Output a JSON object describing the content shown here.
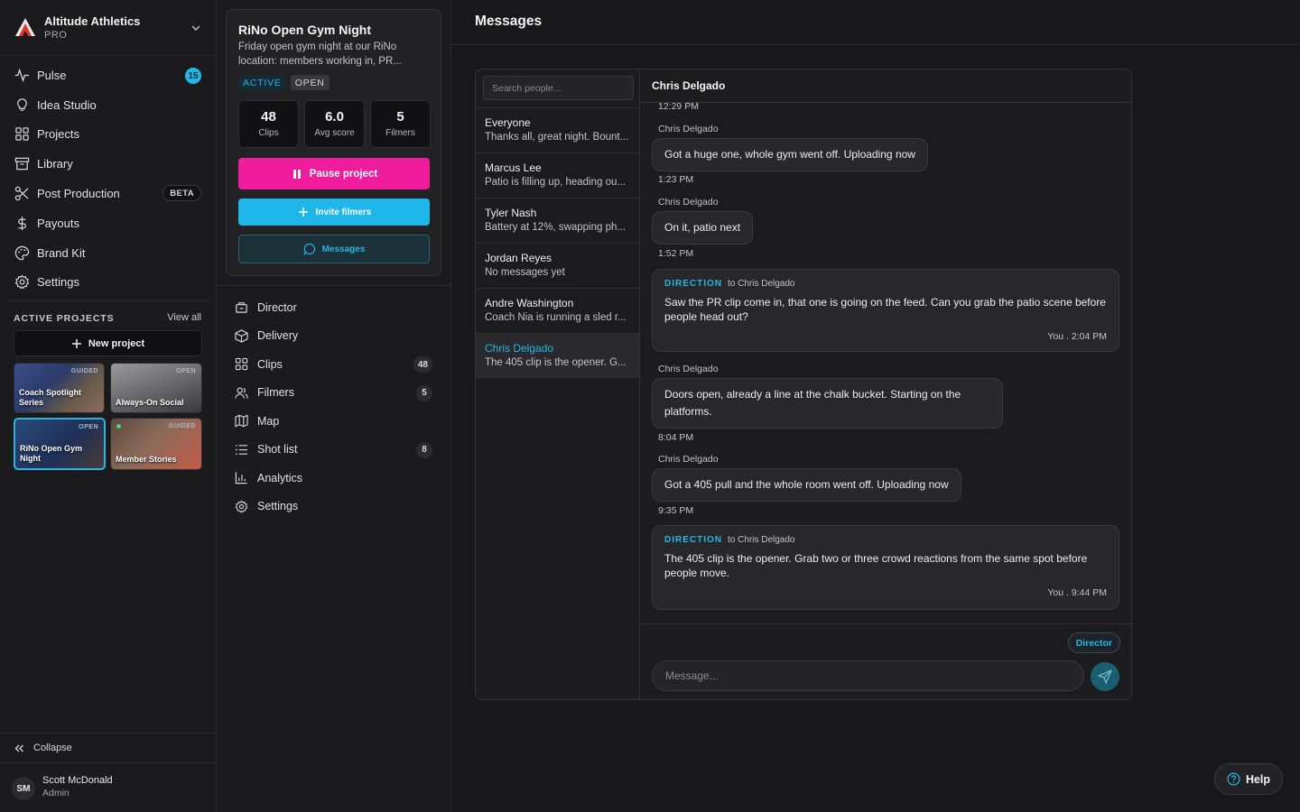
{
  "workspace": {
    "name": "Altitude Athletics",
    "plan": "PRO"
  },
  "sidebar": {
    "items": [
      {
        "label": "Pulse",
        "icon": "pulse-icon",
        "badge": "15"
      },
      {
        "label": "Idea Studio",
        "icon": "lightbulb-icon"
      },
      {
        "label": "Projects",
        "icon": "grid-icon"
      },
      {
        "label": "Library",
        "icon": "archive-icon"
      },
      {
        "label": "Post Production",
        "icon": "scissors-icon",
        "tag": "BETA"
      },
      {
        "label": "Payouts",
        "icon": "dollar-icon"
      },
      {
        "label": "Brand Kit",
        "icon": "palette-icon"
      },
      {
        "label": "Settings",
        "icon": "gear-icon"
      }
    ],
    "active_projects": {
      "title": "ACTIVE PROJECTS",
      "view_all": "View all",
      "new_project": "New project",
      "projects": [
        {
          "title": "Coach Spotlight Series",
          "status": "GUIDED"
        },
        {
          "title": "Always-On Social",
          "status": "OPEN"
        },
        {
          "title": "RiNo Open Gym Night",
          "status": "OPEN"
        },
        {
          "title": "Member Stories",
          "status": "GUIDED"
        }
      ]
    },
    "collapse": "Collapse",
    "user": {
      "initials": "SM",
      "name": "Scott McDonald",
      "role": "Admin"
    }
  },
  "project": {
    "title": "RiNo Open Gym Night",
    "description": "Friday open gym night at our RiNo location: members working in, PR...",
    "status_tag": "ACTIVE",
    "mode_tag": "OPEN",
    "stats": [
      {
        "value": "48",
        "label": "Clips"
      },
      {
        "value": "6.0",
        "label": "Avg score"
      },
      {
        "value": "5",
        "label": "Filmers"
      }
    ],
    "pause_label": "Pause project",
    "invite_label": "Invite filmers",
    "messages_label": "Messages",
    "nav": [
      {
        "label": "Director",
        "icon": "director-icon"
      },
      {
        "label": "Delivery",
        "icon": "package-icon"
      },
      {
        "label": "Clips",
        "icon": "grid-icon",
        "count": "48"
      },
      {
        "label": "Filmers",
        "icon": "users-icon",
        "count": "5"
      },
      {
        "label": "Map",
        "icon": "map-icon"
      },
      {
        "label": "Shot list",
        "icon": "list-icon",
        "count": "8"
      },
      {
        "label": "Analytics",
        "icon": "chart-icon"
      },
      {
        "label": "Settings",
        "icon": "gear-icon"
      }
    ]
  },
  "messages": {
    "title": "Messages",
    "search_placeholder": "Search people...",
    "people": [
      {
        "name": "Everyone",
        "preview": "Thanks all, great night. Bount..."
      },
      {
        "name": "Marcus Lee",
        "preview": "Patio is filling up, heading ou..."
      },
      {
        "name": "Tyler Nash",
        "preview": "Battery at 12%, swapping ph..."
      },
      {
        "name": "Jordan Reyes",
        "preview": "No messages yet"
      },
      {
        "name": "Andre Washington",
        "preview": "Coach Nia is running a sled r..."
      },
      {
        "name": "Chris Delgado",
        "preview": "The 405 clip is the opener. G..."
      }
    ],
    "conversation": {
      "with": "Chris Delgado",
      "top_time": "12:29 PM",
      "thread": [
        {
          "sender": "Chris Delgado",
          "text": "Got a huge one, whole gym went off. Uploading now",
          "time": "1:23 PM"
        },
        {
          "sender": "Chris Delgado",
          "text": "On it, patio next",
          "time": "1:52 PM"
        },
        {
          "direction_label": "DIRECTION",
          "to": "to Chris Delgado",
          "text": "Saw the PR clip come in, that one is going on the feed. Can you grab the patio scene before people head out?",
          "footer": "You . 2:04 PM"
        },
        {
          "sender": "Chris Delgado",
          "text": "Doors open, already a line at the chalk bucket. Starting on the platforms.",
          "time": "8:04 PM"
        },
        {
          "sender": "Chris Delgado",
          "text": "Got a 405 pull and the whole room went off. Uploading now",
          "time": "9:35 PM"
        },
        {
          "direction_label": "DIRECTION",
          "to": "to Chris Delgado",
          "text": "The 405 clip is the opener. Grab two or three crowd reactions from the same spot before people move.",
          "footer": "You . 9:44 PM"
        }
      ],
      "mode_pill": "Director",
      "input_placeholder": "Message..."
    }
  },
  "help_label": "Help",
  "colors": {
    "accent": "#1fb6e9",
    "pause": "#ef1c9e",
    "bg": "#18181a"
  }
}
